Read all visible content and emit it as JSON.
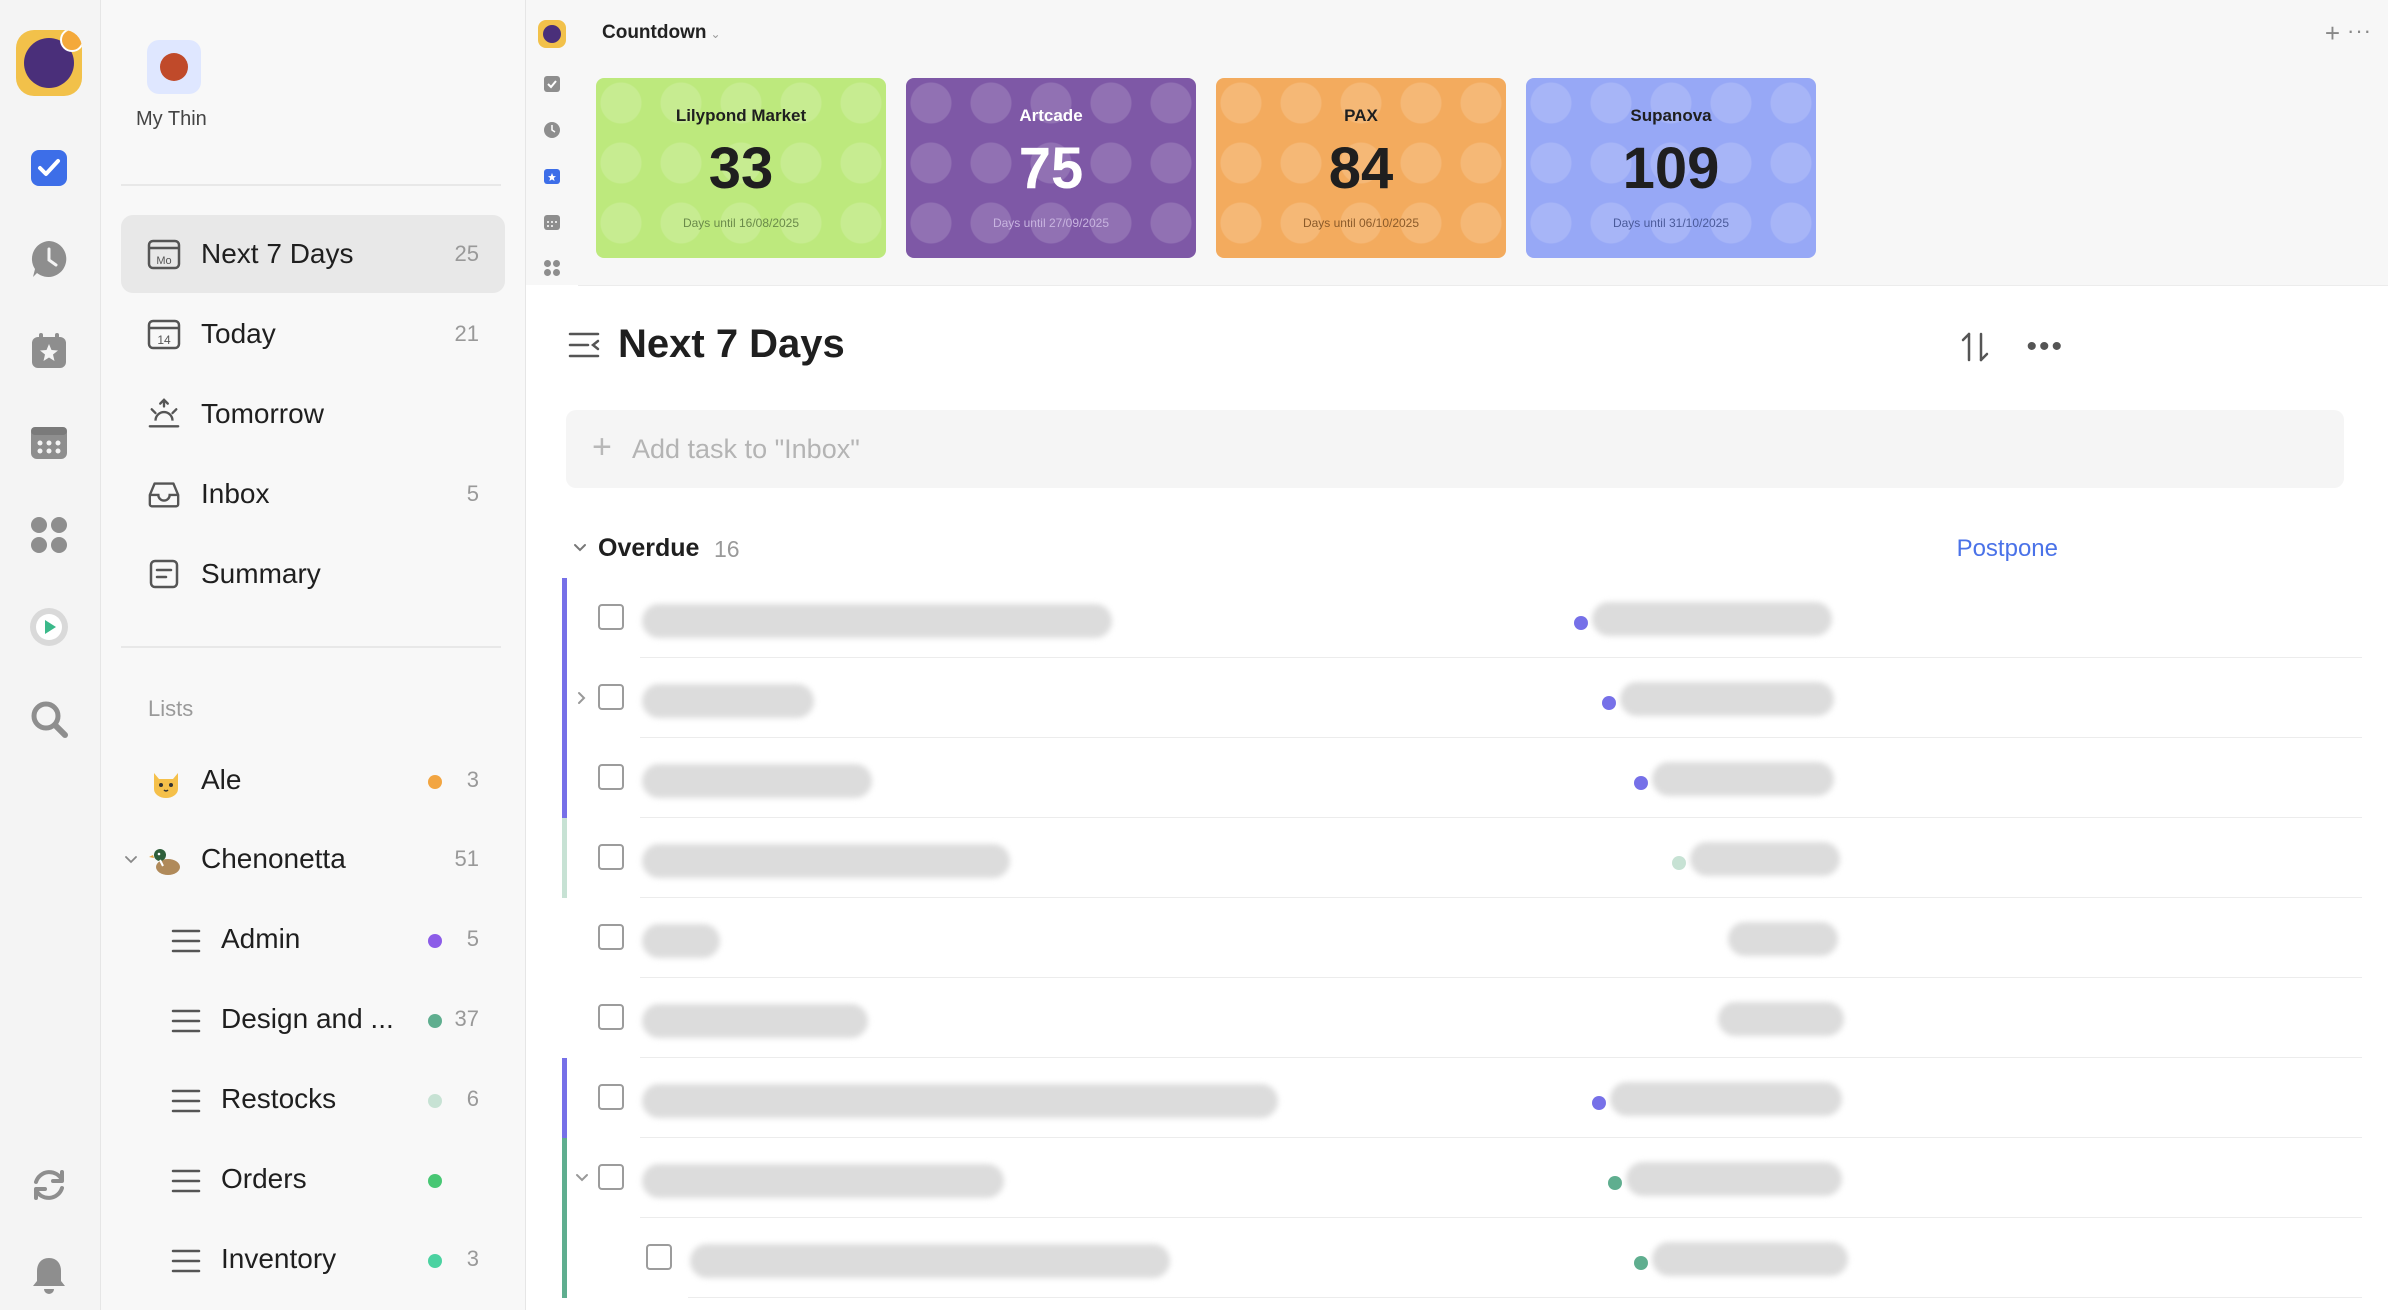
{
  "user": {
    "name": "My Thin"
  },
  "nav": [
    {
      "key": "next7",
      "label": "Next 7 Days",
      "count": "25",
      "icon": "calendar-week-icon"
    },
    {
      "key": "today",
      "label": "Today",
      "count": "21",
      "icon": "calendar-today-icon",
      "icon_text": "14"
    },
    {
      "key": "tomorrow",
      "label": "Tomorrow",
      "count": "",
      "icon": "sunrise-icon"
    },
    {
      "key": "inbox",
      "label": "Inbox",
      "count": "5",
      "icon": "inbox-icon"
    },
    {
      "key": "summary",
      "label": "Summary",
      "count": "",
      "icon": "summary-icon"
    }
  ],
  "nav_day_icon_text": "Mo",
  "lists": {
    "heading": "Lists",
    "items": [
      {
        "label": "Ale",
        "count": "3",
        "dot_color": "#f2a541",
        "emoji": "cat-emoji"
      },
      {
        "label": "Chenonetta",
        "count": "51",
        "emoji": "duck-emoji"
      },
      {
        "label": "Admin",
        "count": "5",
        "dot_color": "#8c5ce8"
      },
      {
        "label": "Design and ...",
        "count": "37",
        "dot_color": "#5fae8f"
      },
      {
        "label": "Restocks",
        "count": "6",
        "dot_color": "#c7e2d4"
      },
      {
        "label": "Orders",
        "count": "",
        "dot_color": "#48c774"
      },
      {
        "label": "Inventory",
        "count": "3",
        "dot_color": "#4bd2a1"
      }
    ]
  },
  "countdown": {
    "title": "Countdown",
    "cards": [
      {
        "name": "Lilypond Market",
        "days": "33",
        "subtitle": "Days until 16/08/2025",
        "color": "#bde97d",
        "text_color": "#1f1f1f"
      },
      {
        "name": "Artcade",
        "days": "75",
        "subtitle": "Days until 27/09/2025",
        "color": "#7e58a6",
        "text_color": "#ffffff"
      },
      {
        "name": "PAX",
        "days": "84",
        "subtitle": "Days until 06/10/2025",
        "color": "#f3ab5e",
        "text_color": "#1f1f1f"
      },
      {
        "name": "Supanova",
        "days": "109",
        "subtitle": "Days until 31/10/2025",
        "color": "#97a8f6",
        "text_color": "#1f1f1f"
      }
    ]
  },
  "main": {
    "title": "Next 7 Days",
    "add_task_placeholder": "Add task to \"Inbox\"",
    "section": {
      "title": "Overdue",
      "count": "16",
      "action": "Postpone"
    }
  },
  "colors": {
    "accent": "#4a72e8",
    "priority_purple": "#7670e8",
    "priority_green": "#5fae8f",
    "priority_lightgreen": "#c7e2d4"
  }
}
